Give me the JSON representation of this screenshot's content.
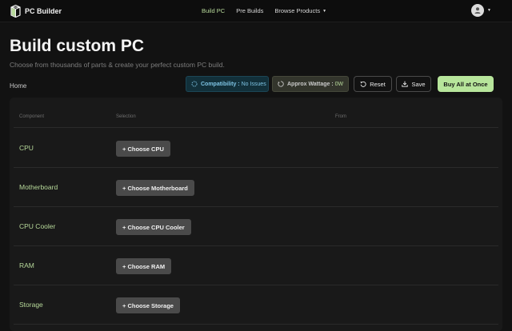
{
  "navbar": {
    "brand": "PC Builder",
    "links": [
      {
        "label": "Build PC",
        "active": true
      },
      {
        "label": "Pre Builds",
        "active": false
      },
      {
        "label": "Browse Products",
        "active": false
      }
    ]
  },
  "header": {
    "title": "Build custom PC",
    "subtitle": "Choose from thousands of parts & create your perfect custom PC build.",
    "breadcrumb": "Home"
  },
  "toolbar": {
    "compatibility_label": "Compatibility :",
    "compatibility_value": "No Issues",
    "wattage_label": "Approx Wattage :",
    "wattage_value": "0W",
    "reset_label": "Reset",
    "save_label": "Save",
    "buy_label": "Buy All at Once"
  },
  "table": {
    "columns": [
      "Component",
      "Selection",
      "From"
    ],
    "rows": [
      {
        "component": "CPU",
        "button": "+ Choose CPU"
      },
      {
        "component": "Motherboard",
        "button": "+ Choose Motherboard"
      },
      {
        "component": "CPU Cooler",
        "button": "+ Choose CPU Cooler"
      },
      {
        "component": "RAM",
        "button": "+ Choose RAM"
      },
      {
        "component": "Storage",
        "button": "+ Choose Storage"
      }
    ]
  },
  "colors": {
    "accent": "#b7e59b",
    "background": "#121212",
    "compatibility": "#7ec4e4"
  },
  "icons": [
    "cube-logo-icon",
    "user-icon",
    "chevron-down-icon",
    "compatibility-icon",
    "wattage-icon",
    "reset-icon",
    "save-icon"
  ]
}
